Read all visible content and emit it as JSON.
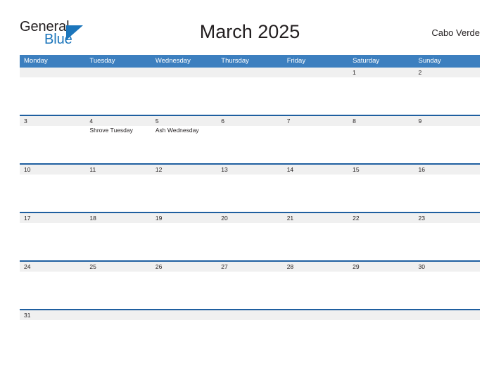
{
  "brand": {
    "name_part1": "General",
    "name_part2": "Blue",
    "flag_icon": "blue-triangle-flag-icon",
    "color_primary": "#1b75bb",
    "color_text": "#231f20"
  },
  "header": {
    "title": "March 2025",
    "location": "Cabo Verde"
  },
  "theme": {
    "header_blue": "#3c7fbf",
    "rule_blue": "#1f5fa0",
    "day_band_gray": "#f0f0f0",
    "cell_white": "#ffffff"
  },
  "calendar": {
    "month": "March",
    "year": "2025",
    "weekday_headers": [
      "Monday",
      "Tuesday",
      "Wednesday",
      "Thursday",
      "Friday",
      "Saturday",
      "Sunday"
    ],
    "weeks": [
      {
        "days": [
          {
            "num": "",
            "events": []
          },
          {
            "num": "",
            "events": []
          },
          {
            "num": "",
            "events": []
          },
          {
            "num": "",
            "events": []
          },
          {
            "num": "",
            "events": []
          },
          {
            "num": "1",
            "events": []
          },
          {
            "num": "2",
            "events": []
          }
        ]
      },
      {
        "days": [
          {
            "num": "3",
            "events": []
          },
          {
            "num": "4",
            "events": [
              "Shrove Tuesday"
            ]
          },
          {
            "num": "5",
            "events": [
              "Ash Wednesday"
            ]
          },
          {
            "num": "6",
            "events": []
          },
          {
            "num": "7",
            "events": []
          },
          {
            "num": "8",
            "events": []
          },
          {
            "num": "9",
            "events": []
          }
        ]
      },
      {
        "days": [
          {
            "num": "10",
            "events": []
          },
          {
            "num": "11",
            "events": []
          },
          {
            "num": "12",
            "events": []
          },
          {
            "num": "13",
            "events": []
          },
          {
            "num": "14",
            "events": []
          },
          {
            "num": "15",
            "events": []
          },
          {
            "num": "16",
            "events": []
          }
        ]
      },
      {
        "days": [
          {
            "num": "17",
            "events": []
          },
          {
            "num": "18",
            "events": []
          },
          {
            "num": "19",
            "events": []
          },
          {
            "num": "20",
            "events": []
          },
          {
            "num": "21",
            "events": []
          },
          {
            "num": "22",
            "events": []
          },
          {
            "num": "23",
            "events": []
          }
        ]
      },
      {
        "days": [
          {
            "num": "24",
            "events": []
          },
          {
            "num": "25",
            "events": []
          },
          {
            "num": "26",
            "events": []
          },
          {
            "num": "27",
            "events": []
          },
          {
            "num": "28",
            "events": []
          },
          {
            "num": "29",
            "events": []
          },
          {
            "num": "30",
            "events": []
          }
        ]
      },
      {
        "days": [
          {
            "num": "31",
            "events": []
          },
          {
            "num": "",
            "events": []
          },
          {
            "num": "",
            "events": []
          },
          {
            "num": "",
            "events": []
          },
          {
            "num": "",
            "events": []
          },
          {
            "num": "",
            "events": []
          },
          {
            "num": "",
            "events": []
          }
        ]
      }
    ]
  }
}
